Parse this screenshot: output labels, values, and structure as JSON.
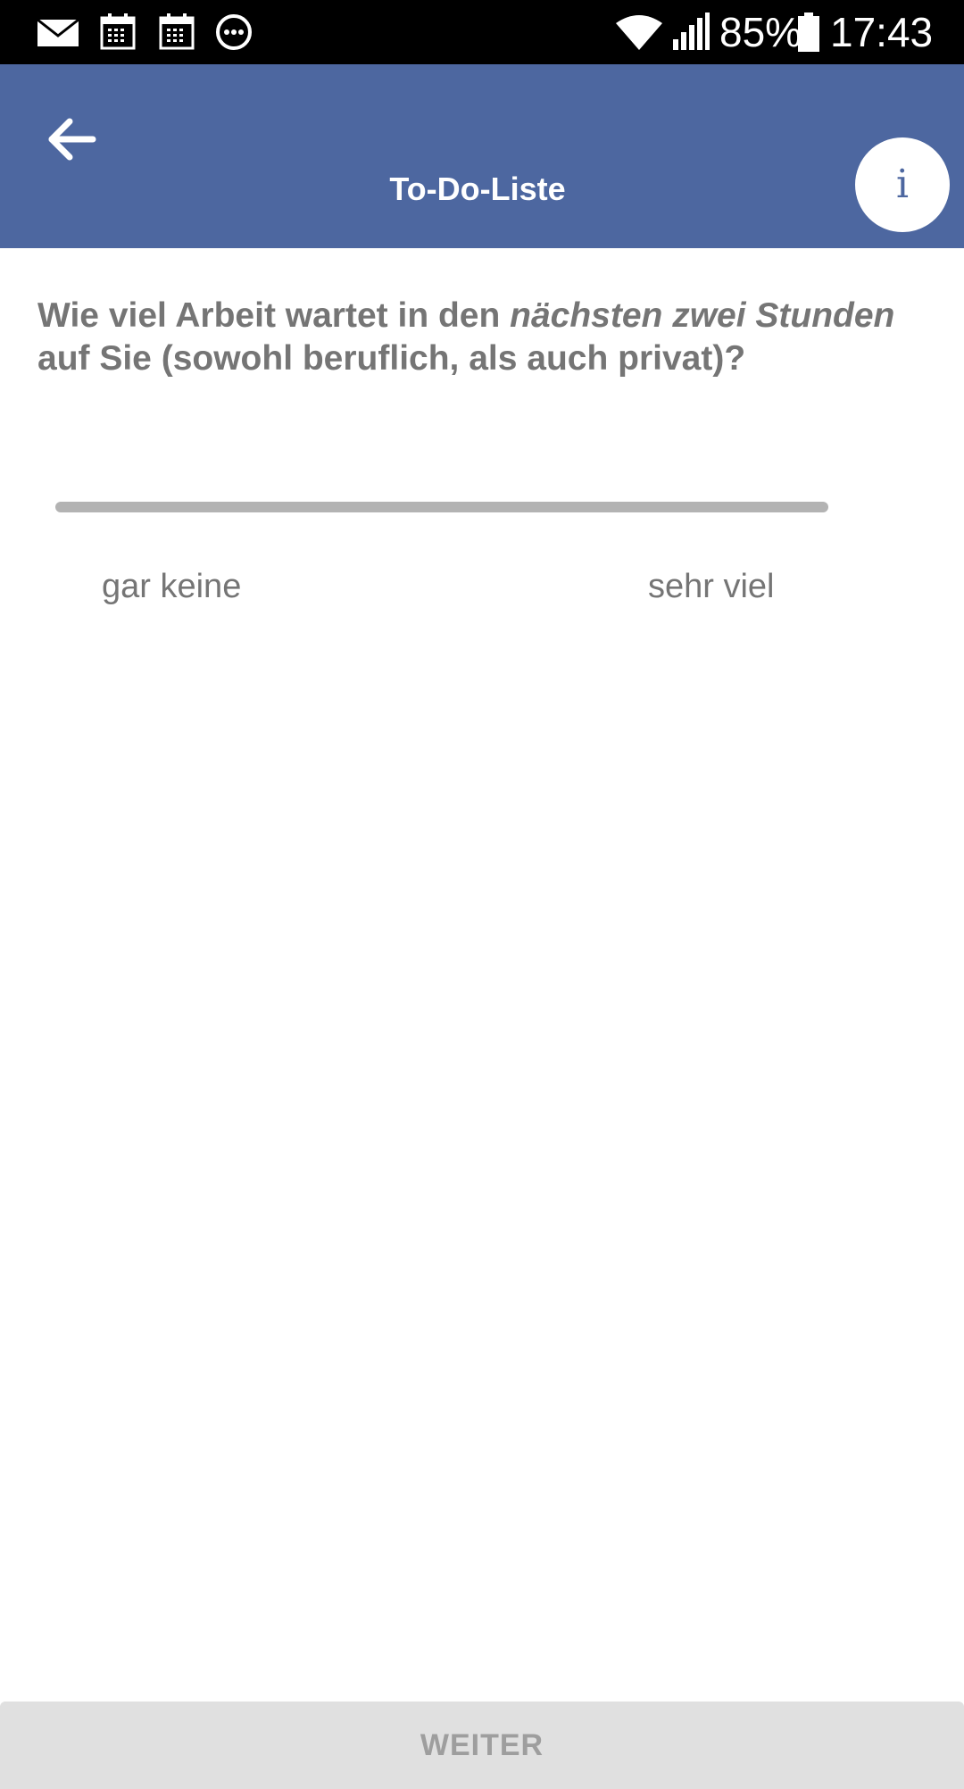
{
  "status_bar": {
    "battery_percent": "85%",
    "time": "17:43",
    "icons": [
      "mail-icon",
      "calendar-icon",
      "calendar-icon",
      "more-horiz-icon",
      "wifi-icon",
      "signal-icon",
      "battery-icon"
    ]
  },
  "app_bar": {
    "title": "To-Do-Liste",
    "back_icon": "arrow-back-icon",
    "info_icon": "info-icon",
    "info_glyph": "i",
    "color": "#4d67a0"
  },
  "question": {
    "part1": "Wie viel Arbeit wartet in den ",
    "emphasis": "nächsten zwei Stunden",
    "part2": " auf Sie (sowohl beruflich, als auch privat)?"
  },
  "slider": {
    "label_min": "gar keine",
    "label_max": "sehr viel"
  },
  "footer": {
    "next_label": "WEITER"
  }
}
